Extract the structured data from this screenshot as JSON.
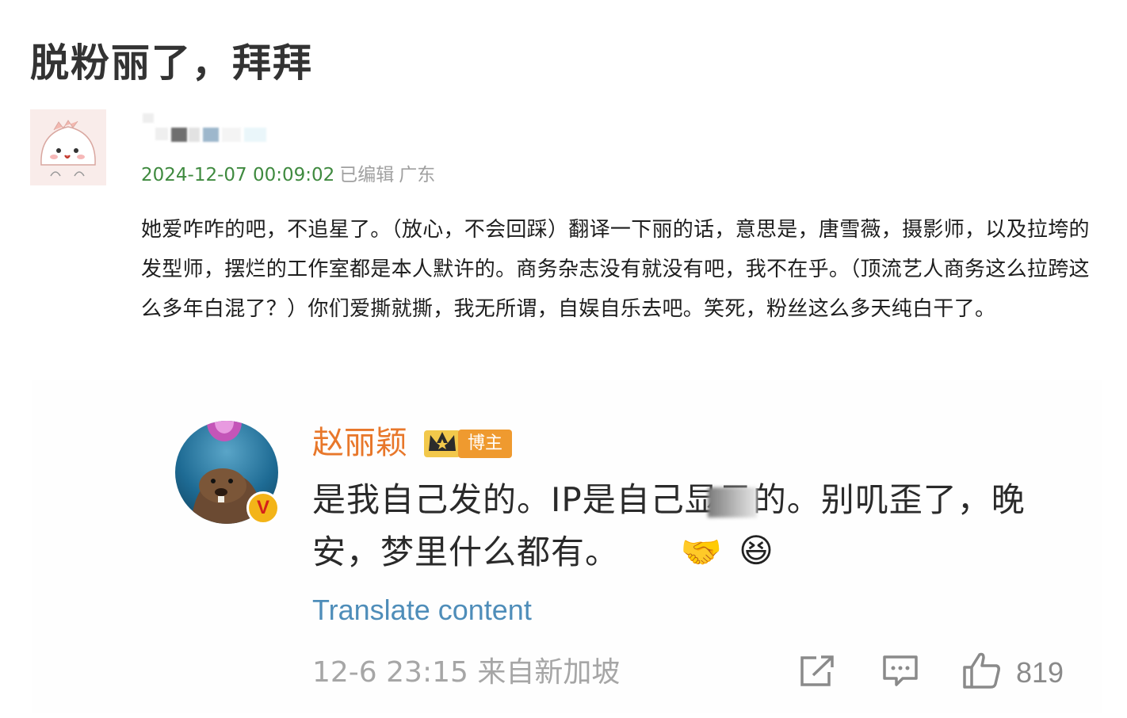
{
  "post": {
    "title": "脱粉丽了，拜拜",
    "timestamp": "2024-12-07 00:09:02",
    "edited": "已编辑",
    "location": "广东",
    "body": "她爱咋咋的吧，不追星了。（放心，不会回踩）翻译一下丽的话，意思是，唐雪薇，摄影师，以及拉垮的发型师，摆烂的工作室都是本人默许的。商务杂志没有就没有吧，我不在乎。（顶流艺人商务这么拉跨这么多年白混了？）你们爱撕就撕，我无所谓，自娱自乐去吧。笑死，粉丝这么多天纯白干了。"
  },
  "embedded_post": {
    "author": "赵丽颖",
    "badge": "博主",
    "verified_mark": "V",
    "text": "是我自己发的。IP是自己显示的。别叽歪了，晚安，梦里什么都有。",
    "emojis": [
      "🤝",
      "😆"
    ],
    "translate_label": "Translate content",
    "time": "12-6 23:15",
    "source": "来自新加坡",
    "likes": "819",
    "colors": {
      "author": "#e8772a",
      "badge": "#ef9a2f",
      "translate": "#4e8db9",
      "timestamp": "#3f8a3f"
    }
  },
  "icons": [
    "crown-icon",
    "share-icon",
    "comment-icon",
    "like-icon",
    "verified-icon"
  ]
}
